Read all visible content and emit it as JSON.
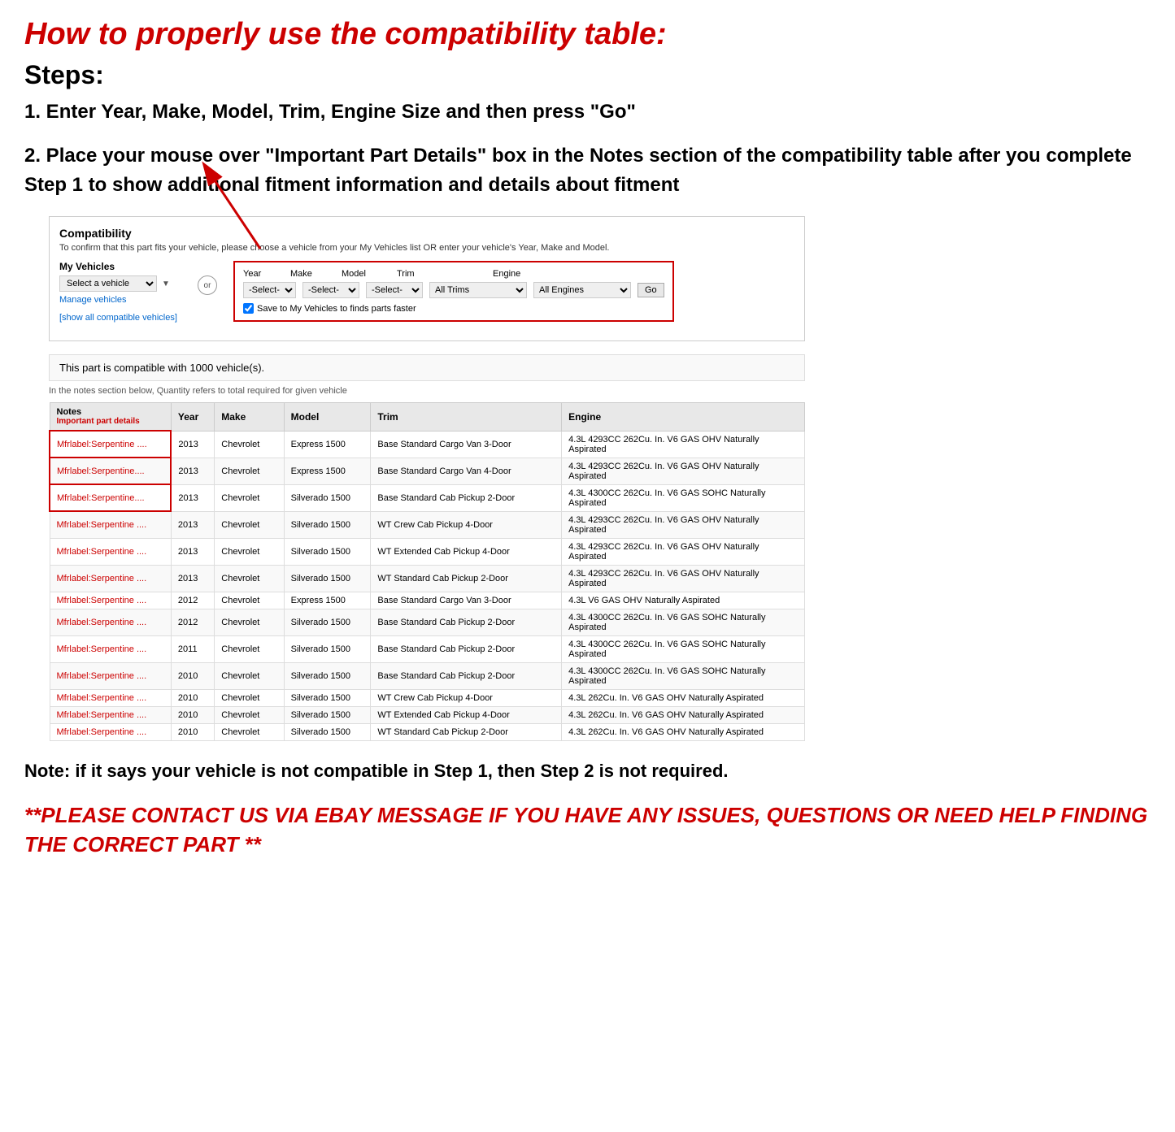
{
  "heading": {
    "title": "How to properly use the compatibility table:",
    "steps_label": "Steps:",
    "step1": "1. Enter Year, Make, Model, Trim, Engine Size and then press \"Go\"",
    "step2": "2. Place your mouse over \"Important Part Details\" box in the Notes section of the compatibility table after you complete Step 1 to show additional fitment information and details about fitment"
  },
  "compatibility_widget": {
    "title": "Compatibility",
    "subtitle": "To confirm that this part fits your vehicle, please choose a vehicle from your My Vehicles list OR enter your vehicle's Year, Make and Model.",
    "my_vehicles_label": "My Vehicles",
    "select_vehicle_placeholder": "Select a vehicle",
    "manage_vehicles": "Manage vehicles",
    "show_all": "[show all compatible vehicles]",
    "or_label": "or",
    "year_label": "Year",
    "make_label": "Make",
    "model_label": "Model",
    "trim_label": "Trim",
    "engine_label": "Engine",
    "year_default": "-Select-",
    "make_default": "-Select-",
    "model_default": "-Select-",
    "trim_default": "All Trims",
    "engine_default": "All Engines",
    "go_button": "Go",
    "save_checkbox_label": "Save to My Vehicles to finds parts faster"
  },
  "compatible_notice": "This part is compatible with 1000 vehicle(s).",
  "qty_notice": "In the notes section below, Quantity refers to total required for given vehicle",
  "table": {
    "headers": [
      "Notes",
      "Year",
      "Make",
      "Model",
      "Trim",
      "Engine"
    ],
    "notes_sub": "Important part details",
    "rows": [
      [
        "Mfrlabel:Serpentine ....",
        "2013",
        "Chevrolet",
        "Express 1500",
        "Base Standard Cargo Van 3-Door",
        "4.3L 4293CC 262Cu. In. V6 GAS OHV Naturally Aspirated"
      ],
      [
        "Mfrlabel:Serpentine....",
        "2013",
        "Chevrolet",
        "Express 1500",
        "Base Standard Cargo Van 4-Door",
        "4.3L 4293CC 262Cu. In. V6 GAS OHV Naturally Aspirated"
      ],
      [
        "Mfrlabel:Serpentine....",
        "2013",
        "Chevrolet",
        "Silverado 1500",
        "Base Standard Cab Pickup 2-Door",
        "4.3L 4300CC 262Cu. In. V6 GAS SOHC Naturally Aspirated"
      ],
      [
        "Mfrlabel:Serpentine ....",
        "2013",
        "Chevrolet",
        "Silverado 1500",
        "WT Crew Cab Pickup 4-Door",
        "4.3L 4293CC 262Cu. In. V6 GAS OHV Naturally Aspirated"
      ],
      [
        "Mfrlabel:Serpentine ....",
        "2013",
        "Chevrolet",
        "Silverado 1500",
        "WT Extended Cab Pickup 4-Door",
        "4.3L 4293CC 262Cu. In. V6 GAS OHV Naturally Aspirated"
      ],
      [
        "Mfrlabel:Serpentine ....",
        "2013",
        "Chevrolet",
        "Silverado 1500",
        "WT Standard Cab Pickup 2-Door",
        "4.3L 4293CC 262Cu. In. V6 GAS OHV Naturally Aspirated"
      ],
      [
        "Mfrlabel:Serpentine ....",
        "2012",
        "Chevrolet",
        "Express 1500",
        "Base Standard Cargo Van 3-Door",
        "4.3L V6 GAS OHV Naturally Aspirated"
      ],
      [
        "Mfrlabel:Serpentine ....",
        "2012",
        "Chevrolet",
        "Silverado 1500",
        "Base Standard Cab Pickup 2-Door",
        "4.3L 4300CC 262Cu. In. V6 GAS SOHC Naturally Aspirated"
      ],
      [
        "Mfrlabel:Serpentine ....",
        "2011",
        "Chevrolet",
        "Silverado 1500",
        "Base Standard Cab Pickup 2-Door",
        "4.3L 4300CC 262Cu. In. V6 GAS SOHC Naturally Aspirated"
      ],
      [
        "Mfrlabel:Serpentine ....",
        "2010",
        "Chevrolet",
        "Silverado 1500",
        "Base Standard Cab Pickup 2-Door",
        "4.3L 4300CC 262Cu. In. V6 GAS SOHC Naturally Aspirated"
      ],
      [
        "Mfrlabel:Serpentine ....",
        "2010",
        "Chevrolet",
        "Silverado 1500",
        "WT Crew Cab Pickup 4-Door",
        "4.3L 262Cu. In. V6 GAS OHV Naturally Aspirated"
      ],
      [
        "Mfrlabel:Serpentine ....",
        "2010",
        "Chevrolet",
        "Silverado 1500",
        "WT Extended Cab Pickup 4-Door",
        "4.3L 262Cu. In. V6 GAS OHV Naturally Aspirated"
      ],
      [
        "Mfrlabel:Serpentine ....",
        "2010",
        "Chevrolet",
        "Silverado 1500",
        "WT Standard Cab Pickup 2-Door",
        "4.3L 262Cu. In. V6 GAS OHV Naturally Aspirated"
      ]
    ]
  },
  "note_text": "Note: if it says your vehicle is not compatible in Step 1, then Step 2 is not required.",
  "contact_text": "**PLEASE CONTACT US VIA EBAY MESSAGE IF YOU HAVE ANY ISSUES, QUESTIONS OR NEED HELP FINDING THE CORRECT PART **"
}
